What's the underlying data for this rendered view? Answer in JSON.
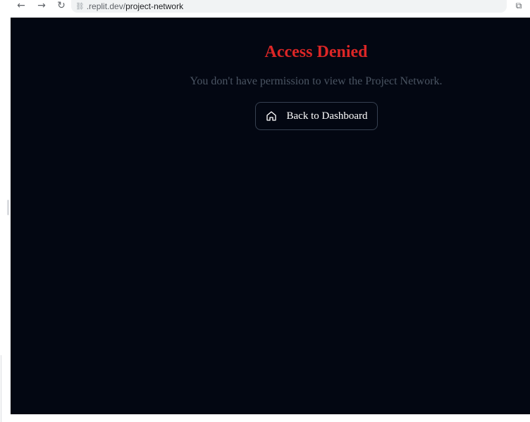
{
  "browser": {
    "back_icon": "arrow-left-icon",
    "forward_icon": "arrow-right-icon",
    "reload_icon": "reload-icon",
    "url_host": ".replit.dev/",
    "url_path": "project-network"
  },
  "page": {
    "title": "Access Denied",
    "message": "You don't have permission to view the Project Network.",
    "back_button_label": "Back to Dashboard"
  },
  "colors": {
    "background": "#030712",
    "title": "#dc2626",
    "message": "#4b5563",
    "button_border": "#374151",
    "button_text": "#ffffff"
  }
}
